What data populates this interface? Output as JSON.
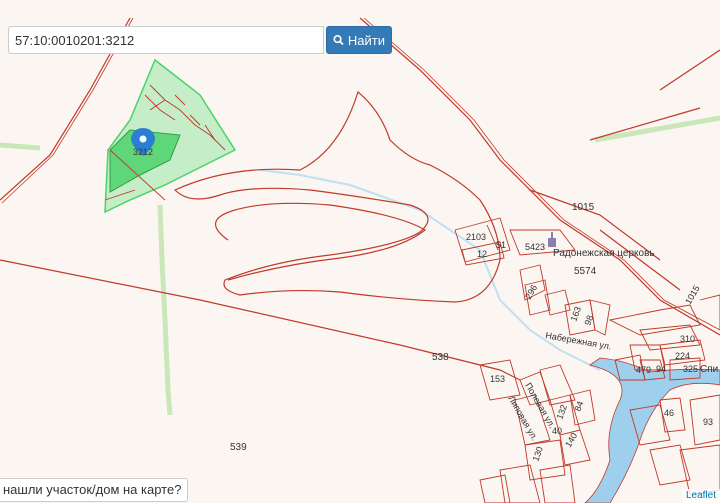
{
  "search": {
    "value": "57:10:0010201:3212",
    "button_label": "Найти"
  },
  "not_found_link": "нашли участок/дом на карте?",
  "attribution": "Leaflet",
  "marker_label": "3212",
  "map": {
    "parcel_labels": {
      "p1015": "1015",
      "p1015b": "1015",
      "p2103": "2103",
      "p51": "51",
      "p12": "12",
      "p5423": "5423",
      "p5574": "5574",
      "p538": "538",
      "p539": "539",
      "p153": "153",
      "p296": "296",
      "p163": "163",
      "p98": "98",
      "p310": "310",
      "p224": "224",
      "p325": "325",
      "p479": "479",
      "p94": "94",
      "p132": "132",
      "p84": "84",
      "p140": "140",
      "p130": "130",
      "p40": "40",
      "p46": "46",
      "p93": "93"
    },
    "place_labels": {
      "church": "Радонежская церковь",
      "street1": "Набережная ул.",
      "street2": "Липовая ул.",
      "street3": "Полевая ул.",
      "village": "Спи"
    },
    "colors": {
      "boundary": "#c0392b",
      "parcel_fill": "#4cd26b",
      "water": "#9ed0ee",
      "green": "#c9e7b8"
    }
  }
}
